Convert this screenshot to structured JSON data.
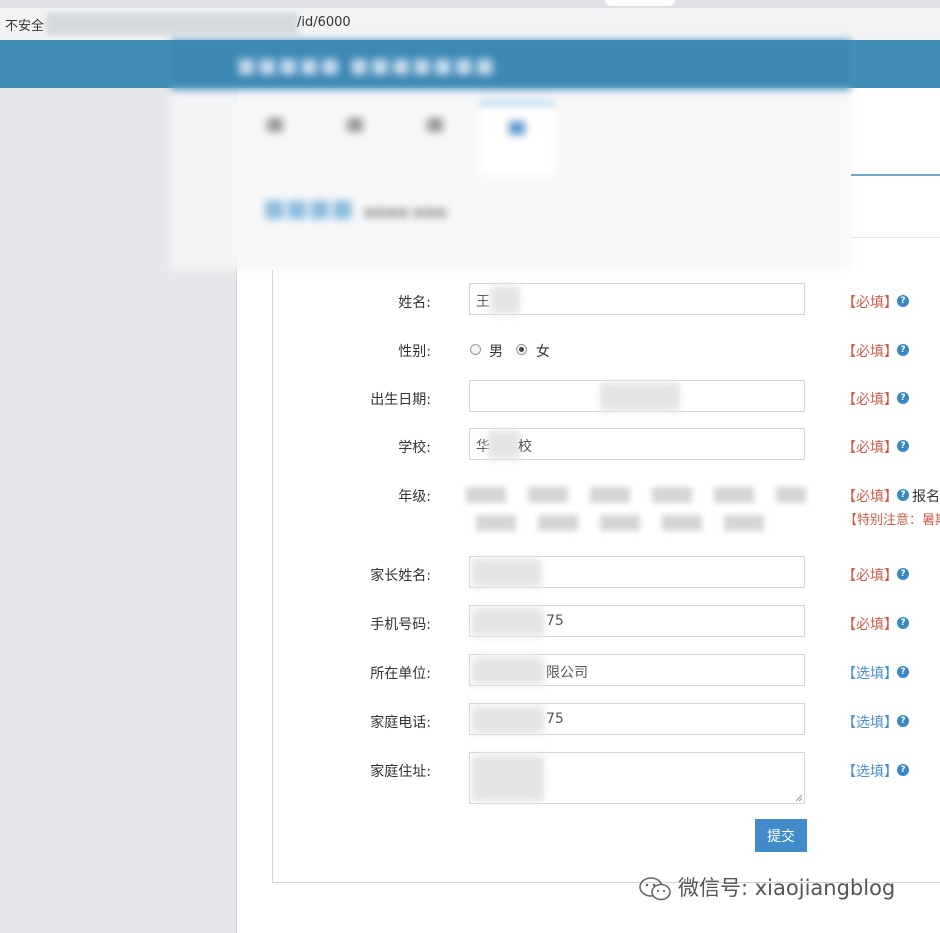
{
  "browser": {
    "security_label": "不安全",
    "url_visible_suffix": "/id/6000"
  },
  "form": {
    "fields": [
      {
        "label": "姓名:",
        "value": "王",
        "tag": "【必填】"
      },
      {
        "label": "性别:",
        "options": [
          "男",
          "女"
        ],
        "selected": "女",
        "tag": "【必填】"
      },
      {
        "label": "出生日期:",
        "value": "",
        "tag": "【必填】"
      },
      {
        "label": "学校:",
        "value_prefix": "华",
        "value_suffix": "校",
        "tag": "【必填】"
      },
      {
        "label": "年级:",
        "tag": "【必填】",
        "extra": "报名",
        "note": "【特别注意：暑期"
      },
      {
        "label": "家长姓名:",
        "value": "",
        "tag": "【必填】"
      },
      {
        "label": "手机号码:",
        "value": "75",
        "tag": "【必填】"
      },
      {
        "label": "所在单位:",
        "value": "限公司",
        "tag": "【选填】"
      },
      {
        "label": "家庭电话:",
        "value": "75",
        "tag": "【选填】"
      },
      {
        "label": "家庭住址:",
        "value": "",
        "tag": "【选填】"
      }
    ],
    "help_glyph": "?",
    "submit_label": "提交"
  },
  "watermark": {
    "text": "微信号: xiaojiangblog"
  },
  "colors": {
    "required": "#d15b47",
    "optional": "#478fca",
    "primary_button": "#428bca",
    "header_blue": "#438eb9"
  }
}
